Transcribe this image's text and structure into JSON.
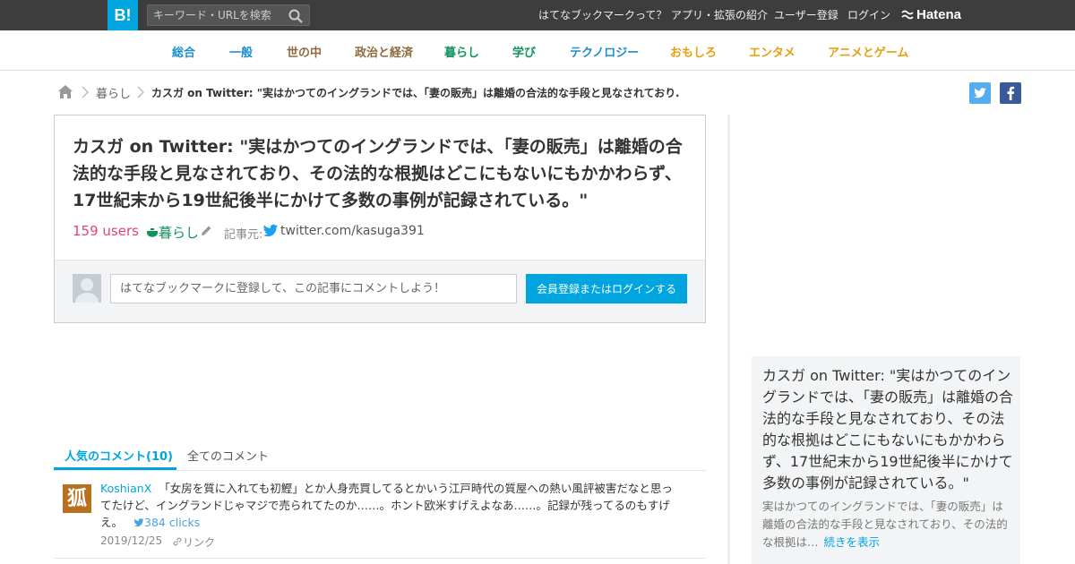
{
  "header": {
    "logo": "B!",
    "search_placeholder": "キーワード・URLを検索",
    "nav": [
      "はてなブックマークって？",
      "アプリ・拡張の紹介",
      "ユーザー登録",
      "ログイン"
    ],
    "brand": "Hatena"
  },
  "categories": [
    {
      "label": "総合",
      "color": "#1b8ecf"
    },
    {
      "label": "一般",
      "color": "#1b8ecf"
    },
    {
      "label": "世の中",
      "color": "#8e6a3d"
    },
    {
      "label": "政治と経済",
      "color": "#8e6a3d"
    },
    {
      "label": "暮らし",
      "color": "#11935e"
    },
    {
      "label": "学び",
      "color": "#11935e"
    },
    {
      "label": "テクノロジー",
      "color": "#1b8ecf"
    },
    {
      "label": "おもしろ",
      "color": "#e6a00f"
    },
    {
      "label": "エンタメ",
      "color": "#e6a00f"
    },
    {
      "label": "アニメとゲーム",
      "color": "#e6a00f"
    }
  ],
  "breadcrumb": {
    "category": "暮らし",
    "current": "カスガ on Twitter: \"実はかつてのイングランドでは、「妻の販売」は離婚の合法的な手段と見なされており…"
  },
  "entry": {
    "title": "カスガ on Twitter: \"実はかつてのイングランドでは、「妻の販売」は離婚の合法的な手段と見なされており、その法的な根拠はどこにもないにもかかわらず、17世紀末から19世紀後半にかけて多数の事例が記録されている。\"",
    "users": "159 users",
    "category": "暮らし",
    "source_label": "記事元:",
    "source": "twitter.com/kasuga391",
    "comment_placeholder": "はてなブックマークに登録して、この記事にコメントしよう！",
    "login_button": "会員登録またはログインする"
  },
  "tabs": {
    "popular": "人気のコメント(10)",
    "all": "全てのコメント"
  },
  "comments": [
    {
      "avatar_char": "狐",
      "user": "KoshianX",
      "text": "「女房を質に入れても初鰹」とか人身売買してるとかいう江戸時代の質屋への熱い風評被害だなと思ってたけど、イングランドじゃマジで売られてたのか……。ホント欧米すげえよなあ……。記録が残ってるのもすげえ。",
      "clicks": "384 clicks",
      "date": "2019/12/25",
      "link": "リンク"
    }
  ],
  "sidebar": {
    "title": "カスガ on Twitter: \"実はかつてのイングランドでは、「妻の販売」は離婚の合法的な手段と見なされており、その法的な根拠はどこにもないにもかかわらず、17世紀末から19世紀後半にかけて多数の事例が記録されている。\"",
    "description": "実はかつてのイングランドでは、「妻の販売」は離婚の合法的な手段と見なされており、その法的な根拠は…",
    "more": "続きを表示"
  },
  "colors": {
    "accent": "#00a4de",
    "users": "#e0466f",
    "header_bg": "#3d3d3d",
    "twitter": "#1da1f2",
    "facebook": "#3b5998"
  }
}
